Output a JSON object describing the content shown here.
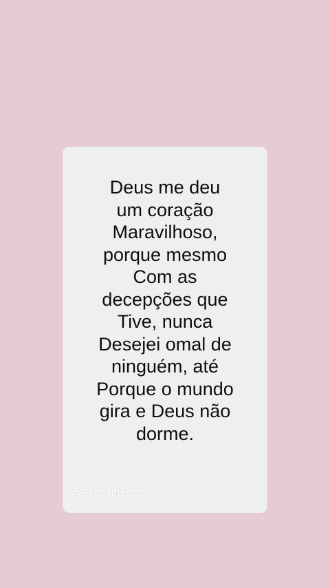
{
  "quote": {
    "lines": [
      "Deus me deu",
      "um coração",
      "Maravilhoso,",
      "porque mesmo",
      "Com as",
      "decepções que",
      "Tive, nunca",
      "Desejei omal de",
      "ninguém, até",
      "Porque o mundo",
      "gira e Deus não",
      "dorme."
    ]
  },
  "watermark": "@Pensamentos",
  "colors": {
    "background": "#e6cbd3",
    "card": "#eef0ee",
    "text": "#0e0e0e"
  }
}
